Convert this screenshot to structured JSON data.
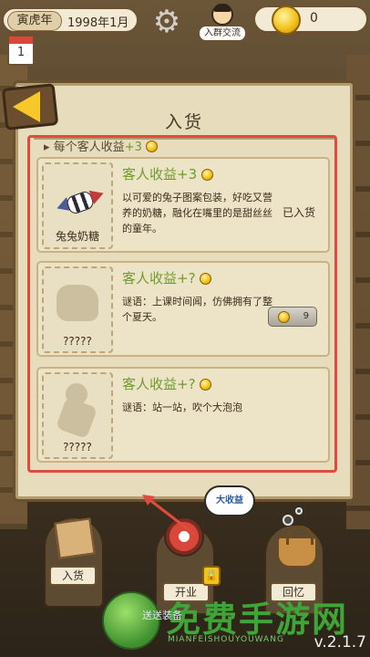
{
  "header": {
    "zodiac_year": "寅虎年",
    "date": "1998年1月",
    "calendar_day": "1",
    "community_label": "入群交流",
    "coins": "0"
  },
  "panel": {
    "title": "入货",
    "subhead_label": "每个客人收益",
    "subhead_value": "+3"
  },
  "items": [
    {
      "name": "兔兔奶糖",
      "income": "客人收益+3",
      "desc": "以可爱的兔子图案包装，好吃又营养的奶糖，融化在嘴里的是甜丝丝的童年。",
      "status": "已入货"
    },
    {
      "name": "?????",
      "income": "客人收益+?",
      "desc": "谜语：上课时间闻，仿佛拥有了整个夏天。",
      "price": "9"
    },
    {
      "name": "?????",
      "income": "客人收益+?",
      "desc": "谜语：站一站，吹个大泡泡"
    }
  ],
  "bottom": {
    "speech": "大收益",
    "nav_stock": "入货",
    "nav_open": "开业",
    "nav_memory": "回忆",
    "hint": "送送装备"
  },
  "watermark": {
    "title": "免费手游网",
    "subtitle": "MIANFEISHOUYOUWANG"
  },
  "version": "v.2.1.7",
  "colors": {
    "accent_green": "#6e9c2e",
    "highlight_red": "#e34a3e",
    "coin_gold": "#f2c31d"
  }
}
